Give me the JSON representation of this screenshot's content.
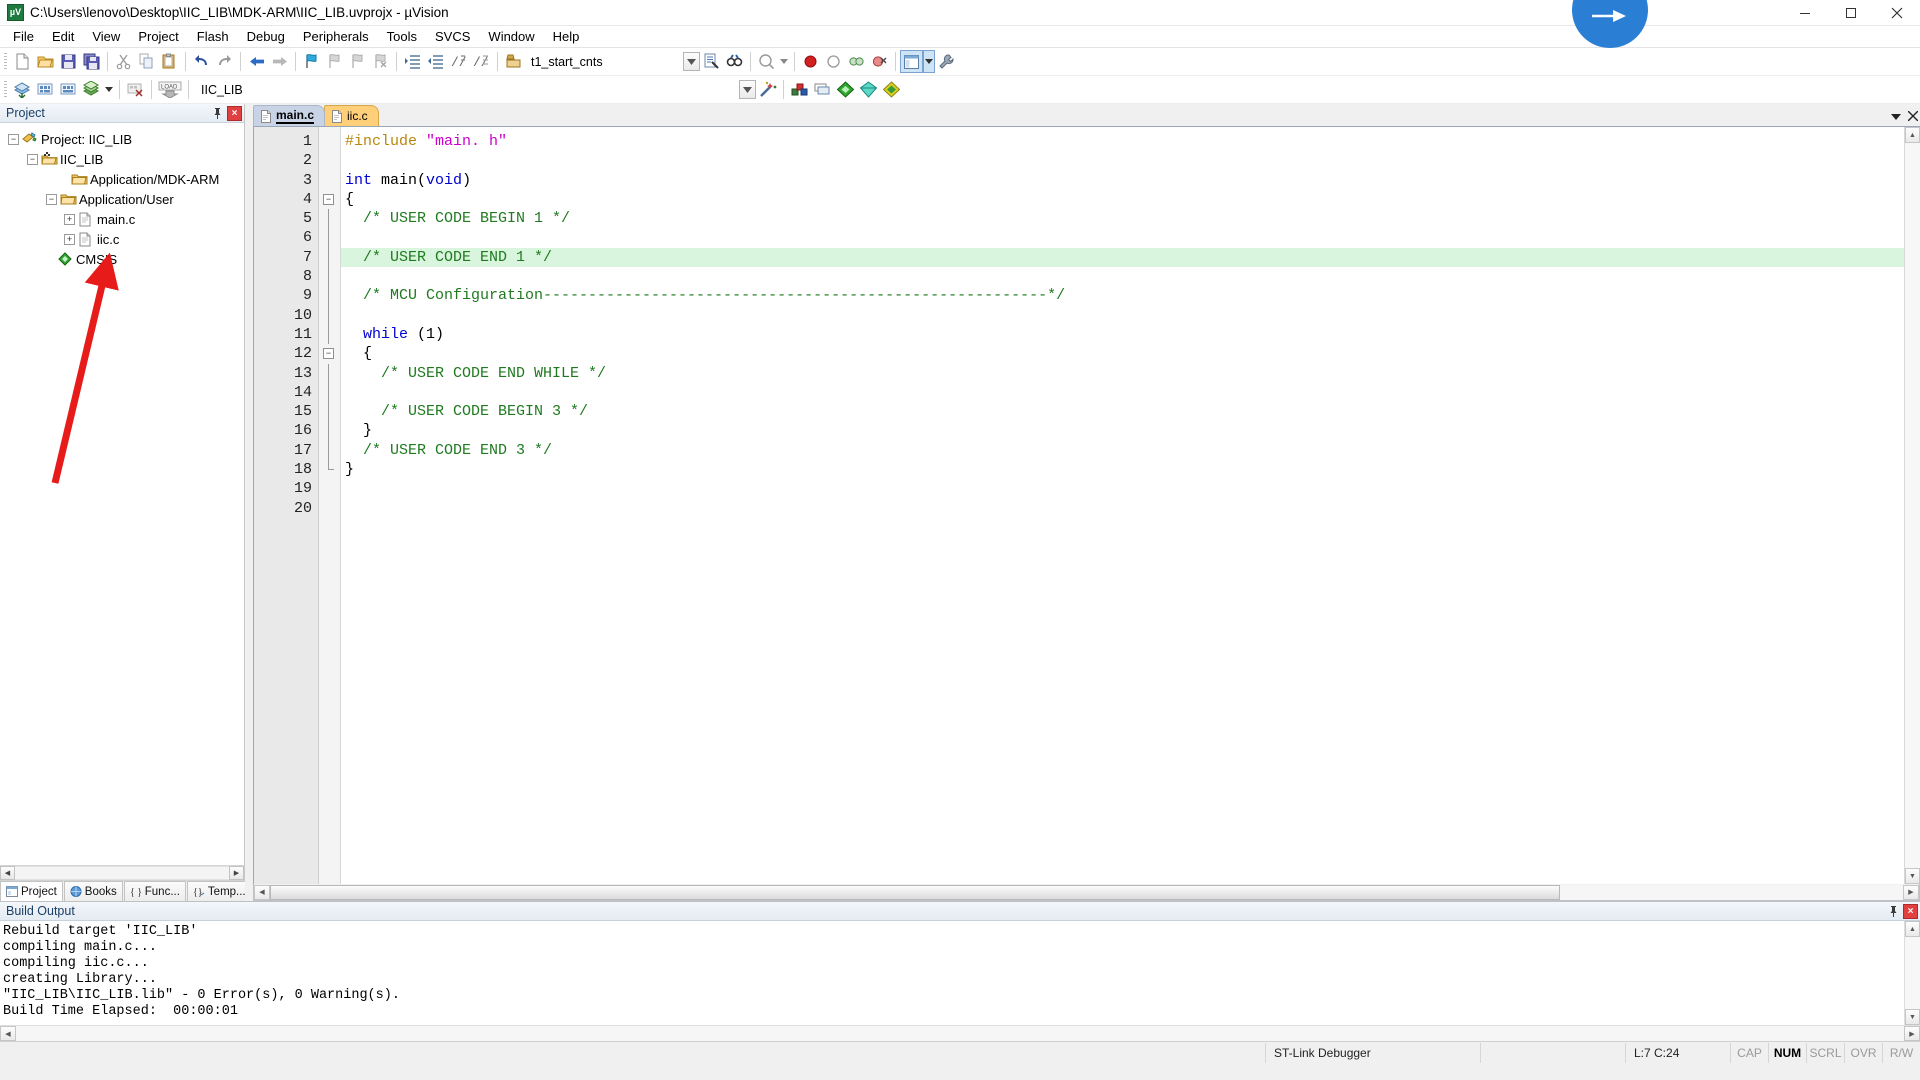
{
  "window": {
    "title": "C:\\Users\\lenovo\\Desktop\\IIC_LIB\\MDK-ARM\\IIC_LIB.uvprojx - µVision",
    "app_icon_text": "µV",
    "minimize_label": "Minimize",
    "maximize_label": "Maximize",
    "close_label": "Close"
  },
  "menu": {
    "items": [
      {
        "label": "File"
      },
      {
        "label": "Edit"
      },
      {
        "label": "View"
      },
      {
        "label": "Project"
      },
      {
        "label": "Flash"
      },
      {
        "label": "Debug"
      },
      {
        "label": "Peripherals"
      },
      {
        "label": "Tools"
      },
      {
        "label": "SVCS"
      },
      {
        "label": "Window"
      },
      {
        "label": "Help"
      }
    ]
  },
  "toolbar_main": {
    "buttons": [
      {
        "name": "new-file-icon",
        "tip": "New"
      },
      {
        "name": "open-file-icon",
        "tip": "Open"
      },
      {
        "name": "save-icon",
        "tip": "Save"
      },
      {
        "name": "save-all-icon",
        "tip": "Save All"
      },
      {
        "name": "cut-icon",
        "tip": "Cut"
      },
      {
        "name": "copy-icon",
        "tip": "Copy"
      },
      {
        "name": "paste-icon",
        "tip": "Paste"
      },
      {
        "name": "undo-icon",
        "tip": "Undo"
      },
      {
        "name": "redo-icon",
        "tip": "Redo"
      },
      {
        "name": "back-icon",
        "tip": "Navigate Backwards"
      },
      {
        "name": "forward-icon",
        "tip": "Navigate Forwards"
      },
      {
        "name": "bookmark-toggle-icon",
        "tip": "Insert/Remove Bookmark"
      },
      {
        "name": "bookmark-prev-icon",
        "tip": "Go to Previous Bookmark"
      },
      {
        "name": "bookmark-next-icon",
        "tip": "Go to Next Bookmark"
      },
      {
        "name": "bookmark-clear-icon",
        "tip": "Clear All Bookmarks"
      },
      {
        "name": "indent-icon",
        "tip": "Indent Selected Text"
      },
      {
        "name": "outdent-icon",
        "tip": "Outdent Selected Text"
      },
      {
        "name": "comment-icon",
        "tip": "Comment Selection"
      },
      {
        "name": "uncomment-icon",
        "tip": "Uncomment Selection"
      }
    ],
    "find_box_icon": "binoculars-icon",
    "find_value": "t1_start_cnts",
    "find_dropdown_icon": "chevron-down-icon",
    "bookmark_list_icon": "document-search-icon",
    "find_in_files_icon": "binoculars-icon",
    "magnify_icon": "magnifier-icon",
    "magnify_dropdown_icon": "chevron-down-icon",
    "breakpoint_icon": "breakpoint-red-dot-icon",
    "breakpoint_disable_icon": "breakpoint-hollow-icon",
    "breakpoint_disable_all_icon": "breakpoint-chain-icon",
    "kill_breakpoints_icon": "breakpoint-kill-icon",
    "window_layout_icon": "window-layout-icon",
    "window_layout_dropdown_icon": "chevron-down-icon",
    "configure_icon": "wrench-icon"
  },
  "toolbar_build": {
    "buttons": [
      {
        "name": "translate-icon",
        "tip": "Translate"
      },
      {
        "name": "build-icon",
        "tip": "Build"
      },
      {
        "name": "rebuild-icon",
        "tip": "Rebuild"
      },
      {
        "name": "batch-build-icon",
        "tip": "Batch Build"
      },
      {
        "name": "batch-build-dropdown-icon",
        "tip": "Batch Build options"
      },
      {
        "name": "stop-build-icon",
        "tip": "Stop Build"
      },
      {
        "name": "download-icon",
        "tip": "Download"
      }
    ],
    "target_value": "IIC_LIB",
    "target_dropdown_icon": "chevron-down-icon",
    "target_options_icon": "magic-wand-icon",
    "right_buttons": [
      {
        "name": "target-options-icon",
        "tip": "Options for Target"
      },
      {
        "name": "manage-project-items-icon",
        "tip": "Manage Project Items"
      },
      {
        "name": "pack-installer-icon",
        "tip": "Pack Installer"
      },
      {
        "name": "manage-rte-icon",
        "tip": "Manage Run-Time Environment"
      },
      {
        "name": "multi-project-icon",
        "tip": "Manage Multi-Project Workspace"
      }
    ]
  },
  "project_panel": {
    "caption": "Project",
    "pin_icon": "pin-icon",
    "close_icon": "close-icon",
    "tree": [
      {
        "label": "Project: IIC_LIB",
        "depth": 0,
        "expander": "minus",
        "icon": "project-icon"
      },
      {
        "label": "IIC_LIB",
        "depth": 1,
        "expander": "minus",
        "icon": "target-icon"
      },
      {
        "label": "Application/MDK-ARM",
        "depth": 2,
        "expander": "none",
        "icon": "folder-icon"
      },
      {
        "label": "Application/User",
        "depth": 2,
        "expander": "minus",
        "icon": "folder-icon"
      },
      {
        "label": "main.c",
        "depth": 3,
        "expander": "plus",
        "icon": "c-file-icon"
      },
      {
        "label": "iic.c",
        "depth": 3,
        "expander": "plus",
        "icon": "c-file-icon"
      },
      {
        "label": "CMSIS",
        "depth": 2,
        "expander": "none",
        "icon": "cmsis-icon"
      }
    ],
    "annotation": {
      "name": "red-arrow-annotation",
      "color": "#e81b1b"
    },
    "hscroll_left_icon": "chevron-left-icon",
    "hscroll_right_icon": "chevron-right-icon",
    "tabs": [
      {
        "label": "Project",
        "icon": "project-tab-icon",
        "active": true
      },
      {
        "label": "Books",
        "icon": "books-tab-icon",
        "active": false
      },
      {
        "label": "Func...",
        "icon": "functions-tab-icon",
        "active": false
      },
      {
        "label": "Temp...",
        "icon": "templates-tab-icon",
        "active": false
      }
    ]
  },
  "editor": {
    "tabs": [
      {
        "label": "main.c",
        "icon": "c-file-icon",
        "active": true,
        "modified": false
      },
      {
        "label": "iic.c",
        "icon": "c-file-icon",
        "active": false,
        "modified": true
      }
    ],
    "tabstrip_dropdown_icon": "chevron-down-icon",
    "tabstrip_close_icon": "close-icon",
    "line_numbers": [
      1,
      2,
      3,
      4,
      5,
      6,
      7,
      8,
      9,
      10,
      11,
      12,
      13,
      14,
      15,
      16,
      17,
      18,
      19,
      20
    ],
    "highlight_line": 7,
    "lines": [
      {
        "n": 1,
        "tokens": [
          {
            "t": "#include ",
            "c": "pre"
          },
          {
            "t": "\"main. h\"",
            "c": "str"
          }
        ]
      },
      {
        "n": 2,
        "tokens": []
      },
      {
        "n": 3,
        "tokens": [
          {
            "t": "int",
            "c": "kw"
          },
          {
            "t": " main",
            "c": "pl"
          },
          {
            "t": "(",
            "c": "pl"
          },
          {
            "t": "void",
            "c": "kw"
          },
          {
            "t": ")",
            "c": "pl"
          }
        ]
      },
      {
        "n": 4,
        "tokens": [
          {
            "t": "{",
            "c": "pl"
          }
        ]
      },
      {
        "n": 5,
        "tokens": [
          {
            "t": "  /* USER CODE BEGIN 1 */",
            "c": "cmt"
          }
        ]
      },
      {
        "n": 6,
        "tokens": []
      },
      {
        "n": 7,
        "tokens": [
          {
            "t": "  /* USER CODE END 1 */",
            "c": "cmt"
          }
        ]
      },
      {
        "n": 8,
        "tokens": []
      },
      {
        "n": 9,
        "tokens": [
          {
            "t": "  /* MCU Configuration--------------------------------------------------------*/",
            "c": "cmt"
          }
        ]
      },
      {
        "n": 10,
        "tokens": []
      },
      {
        "n": 11,
        "tokens": [
          {
            "t": "  ",
            "c": "pl"
          },
          {
            "t": "while",
            "c": "kw"
          },
          {
            "t": " (1)",
            "c": "pl"
          }
        ]
      },
      {
        "n": 12,
        "tokens": [
          {
            "t": "  {",
            "c": "pl"
          }
        ]
      },
      {
        "n": 13,
        "tokens": [
          {
            "t": "    /* USER CODE END WHILE */",
            "c": "cmt"
          }
        ]
      },
      {
        "n": 14,
        "tokens": []
      },
      {
        "n": 15,
        "tokens": [
          {
            "t": "    /* USER CODE BEGIN 3 */",
            "c": "cmt"
          }
        ]
      },
      {
        "n": 16,
        "tokens": [
          {
            "t": "  }",
            "c": "pl"
          }
        ]
      },
      {
        "n": 17,
        "tokens": [
          {
            "t": "  /* USER CODE END 3 */",
            "c": "cmt"
          }
        ]
      },
      {
        "n": 18,
        "tokens": [
          {
            "t": "}",
            "c": "pl"
          }
        ]
      },
      {
        "n": 19,
        "tokens": []
      },
      {
        "n": 20,
        "tokens": []
      }
    ],
    "folds": [
      {
        "line": 4,
        "type": "box-minus"
      },
      {
        "line": 12,
        "type": "box-minus"
      }
    ]
  },
  "build_output": {
    "caption": "Build Output",
    "pin_icon": "pin-icon",
    "close_icon": "close-icon",
    "text": "Rebuild target 'IIC_LIB'\ncompiling main.c...\ncompiling iic.c...\ncreating Library...\n\"IIC_LIB\\IIC_LIB.lib\" - 0 Error(s), 0 Warning(s).\nBuild Time Elapsed:  00:00:01"
  },
  "statusbar": {
    "debugger": "ST-Link Debugger",
    "position": "L:7 C:24",
    "indicators": [
      {
        "label": "CAP",
        "on": false
      },
      {
        "label": "NUM",
        "on": true
      },
      {
        "label": "SCRL",
        "on": false
      },
      {
        "label": "OVR",
        "on": false
      },
      {
        "label": "R/W",
        "on": false
      }
    ]
  },
  "colors": {
    "comment_green": "#1f7a1f",
    "keyword_blue": "#0000d0",
    "string_magenta": "#cc00cc",
    "preproc_olive": "#b8860b",
    "highlight_line_bg": "#d9f5dd",
    "active_tab_bg": "#c8d4e6",
    "modified_tab_bg": "#ffcf7a",
    "annotation_red": "#e81b1b"
  }
}
